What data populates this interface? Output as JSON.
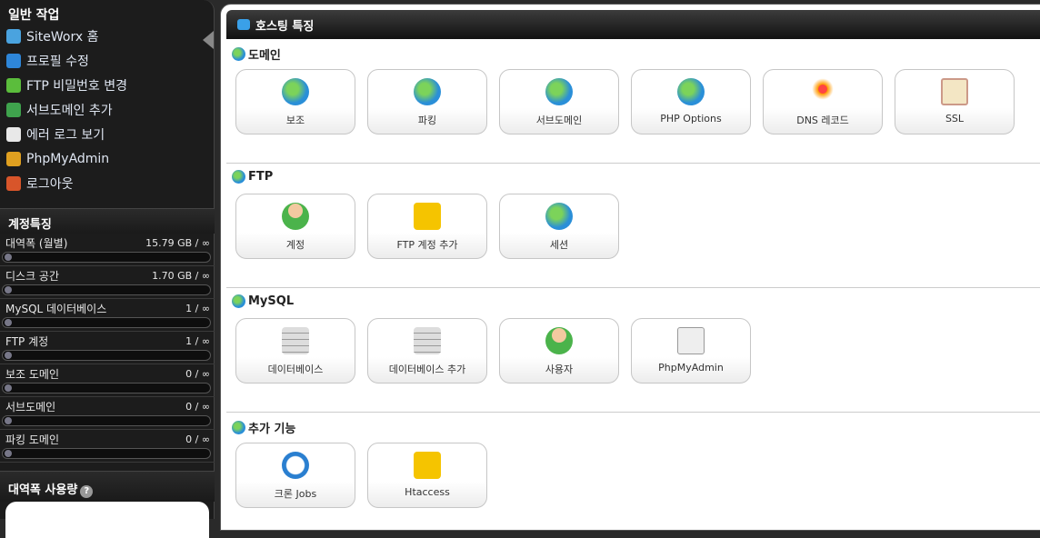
{
  "sidebar": {
    "title": "일반 작업",
    "items": [
      {
        "label": "SiteWorx 홈",
        "icon": "home-icon",
        "color": "#4aa3df"
      },
      {
        "label": "프로필 수정",
        "icon": "profile-icon",
        "color": "#2e86d8"
      },
      {
        "label": "FTP 비밀번호 변경",
        "icon": "user-icon",
        "color": "#5bbd3c"
      },
      {
        "label": "서브도메인 추가",
        "icon": "globe-add-icon",
        "color": "#3fa34d"
      },
      {
        "label": "에러 로그 보기",
        "icon": "document-icon",
        "color": "#e8e8e8"
      },
      {
        "label": "PhpMyAdmin",
        "icon": "phpmyadmin-icon",
        "color": "#e0a020"
      },
      {
        "label": "로그아웃",
        "icon": "logout-icon",
        "color": "#d8552a"
      }
    ]
  },
  "account": {
    "title": "계정특징",
    "stats": [
      {
        "label": "대역폭 (월별)",
        "value": "15.79 GB / ∞",
        "percent": 0
      },
      {
        "label": "디스크 공간",
        "value": "1.70 GB / ∞",
        "percent": 0
      },
      {
        "label": "MySQL 데이터베이스",
        "value": "1 / ∞",
        "percent": 0
      },
      {
        "label": "FTP 계정",
        "value": "1 / ∞",
        "percent": 0
      },
      {
        "label": "보조 도메인",
        "value": "0 / ∞",
        "percent": 0
      },
      {
        "label": "서브도메인",
        "value": "0 / ∞",
        "percent": 0
      },
      {
        "label": "파킹 도메인",
        "value": "0 / ∞",
        "percent": 0
      }
    ]
  },
  "bandwidth": {
    "title": "대역폭 사용량",
    "help": "?"
  },
  "main": {
    "title": "호스팅 특징",
    "sections": [
      {
        "title": "도메인",
        "buttons": [
          {
            "label": "보조",
            "icon": "globe"
          },
          {
            "label": "파킹",
            "icon": "globe"
          },
          {
            "label": "서브도메인",
            "icon": "globe"
          },
          {
            "label": "PHP Options",
            "icon": "globe"
          },
          {
            "label": "DNS 레코드",
            "icon": "dns"
          },
          {
            "label": "SSL",
            "icon": "ssl"
          }
        ]
      },
      {
        "title": "FTP",
        "buttons": [
          {
            "label": "계정",
            "icon": "user"
          },
          {
            "label": "FTP 계정 추가",
            "icon": "folder"
          },
          {
            "label": "세션",
            "icon": "globe"
          }
        ]
      },
      {
        "title": "MySQL",
        "buttons": [
          {
            "label": "데이터베이스",
            "icon": "db"
          },
          {
            "label": "데이터베이스 추가",
            "icon": "db"
          },
          {
            "label": "사용자",
            "icon": "user"
          },
          {
            "label": "PhpMyAdmin",
            "icon": "pma"
          }
        ]
      },
      {
        "title": "추가 기능",
        "buttons": [
          {
            "label": "크론 Jobs",
            "icon": "clock"
          },
          {
            "label": "Htaccess",
            "icon": "folder"
          }
        ]
      }
    ]
  }
}
